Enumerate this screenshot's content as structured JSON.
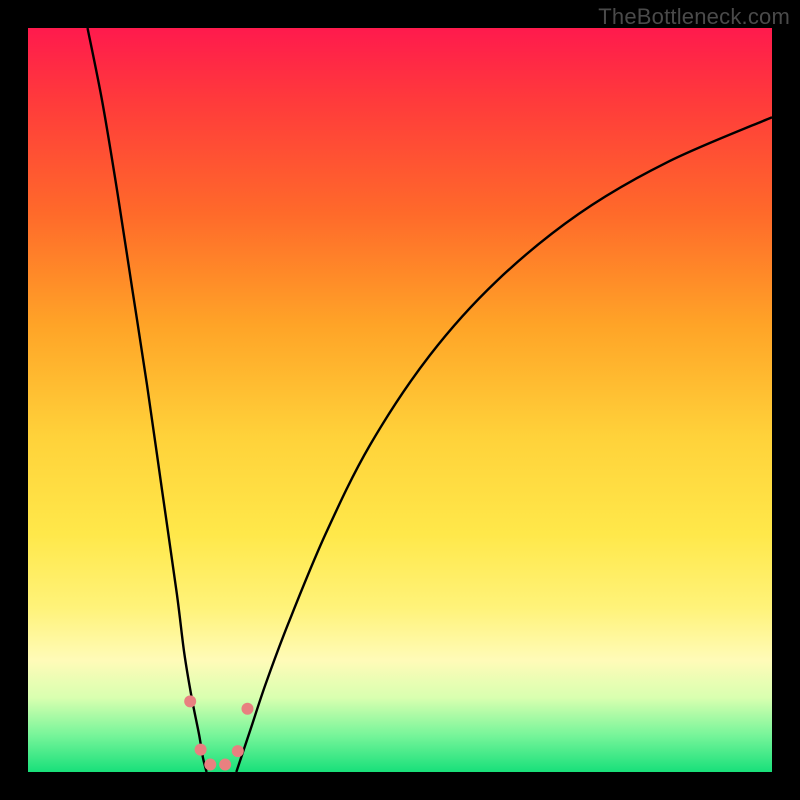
{
  "watermark": "TheBottleneck.com",
  "chart_data": {
    "type": "line",
    "title": "",
    "xlabel": "",
    "ylabel": "",
    "xlim": [
      0,
      100
    ],
    "ylim": [
      0,
      100
    ],
    "series": [
      {
        "name": "left-curve",
        "x": [
          8,
          10,
          12,
          14,
          16,
          18,
          20,
          21,
          22,
          23,
          23.5,
          24
        ],
        "y": [
          100,
          90,
          78,
          65,
          52,
          38,
          24,
          16,
          10,
          5,
          2,
          0
        ]
      },
      {
        "name": "right-curve",
        "x": [
          28,
          29,
          30,
          32,
          35,
          40,
          46,
          54,
          63,
          74,
          86,
          100
        ],
        "y": [
          0,
          3,
          6,
          12,
          20,
          32,
          44,
          56,
          66,
          75,
          82,
          88
        ]
      }
    ],
    "markers": {
      "name": "trough-markers",
      "color": "#e88080",
      "points": [
        {
          "x": 21.8,
          "y": 9.5,
          "r": 6
        },
        {
          "x": 23.2,
          "y": 3.0,
          "r": 6
        },
        {
          "x": 24.5,
          "y": 1.0,
          "r": 6
        },
        {
          "x": 26.5,
          "y": 1.0,
          "r": 6
        },
        {
          "x": 28.2,
          "y": 2.8,
          "r": 6
        },
        {
          "x": 29.5,
          "y": 8.5,
          "r": 6
        }
      ]
    },
    "gradient_stops": [
      {
        "pos": 0,
        "color": "#ff1a4d"
      },
      {
        "pos": 10,
        "color": "#ff3b3b"
      },
      {
        "pos": 25,
        "color": "#ff6a2a"
      },
      {
        "pos": 40,
        "color": "#ffa427"
      },
      {
        "pos": 55,
        "color": "#ffd23a"
      },
      {
        "pos": 68,
        "color": "#ffe84a"
      },
      {
        "pos": 78,
        "color": "#fff37a"
      },
      {
        "pos": 85,
        "color": "#fffbb8"
      },
      {
        "pos": 90,
        "color": "#d9ffb0"
      },
      {
        "pos": 95,
        "color": "#78f59a"
      },
      {
        "pos": 100,
        "color": "#18e07a"
      }
    ]
  }
}
